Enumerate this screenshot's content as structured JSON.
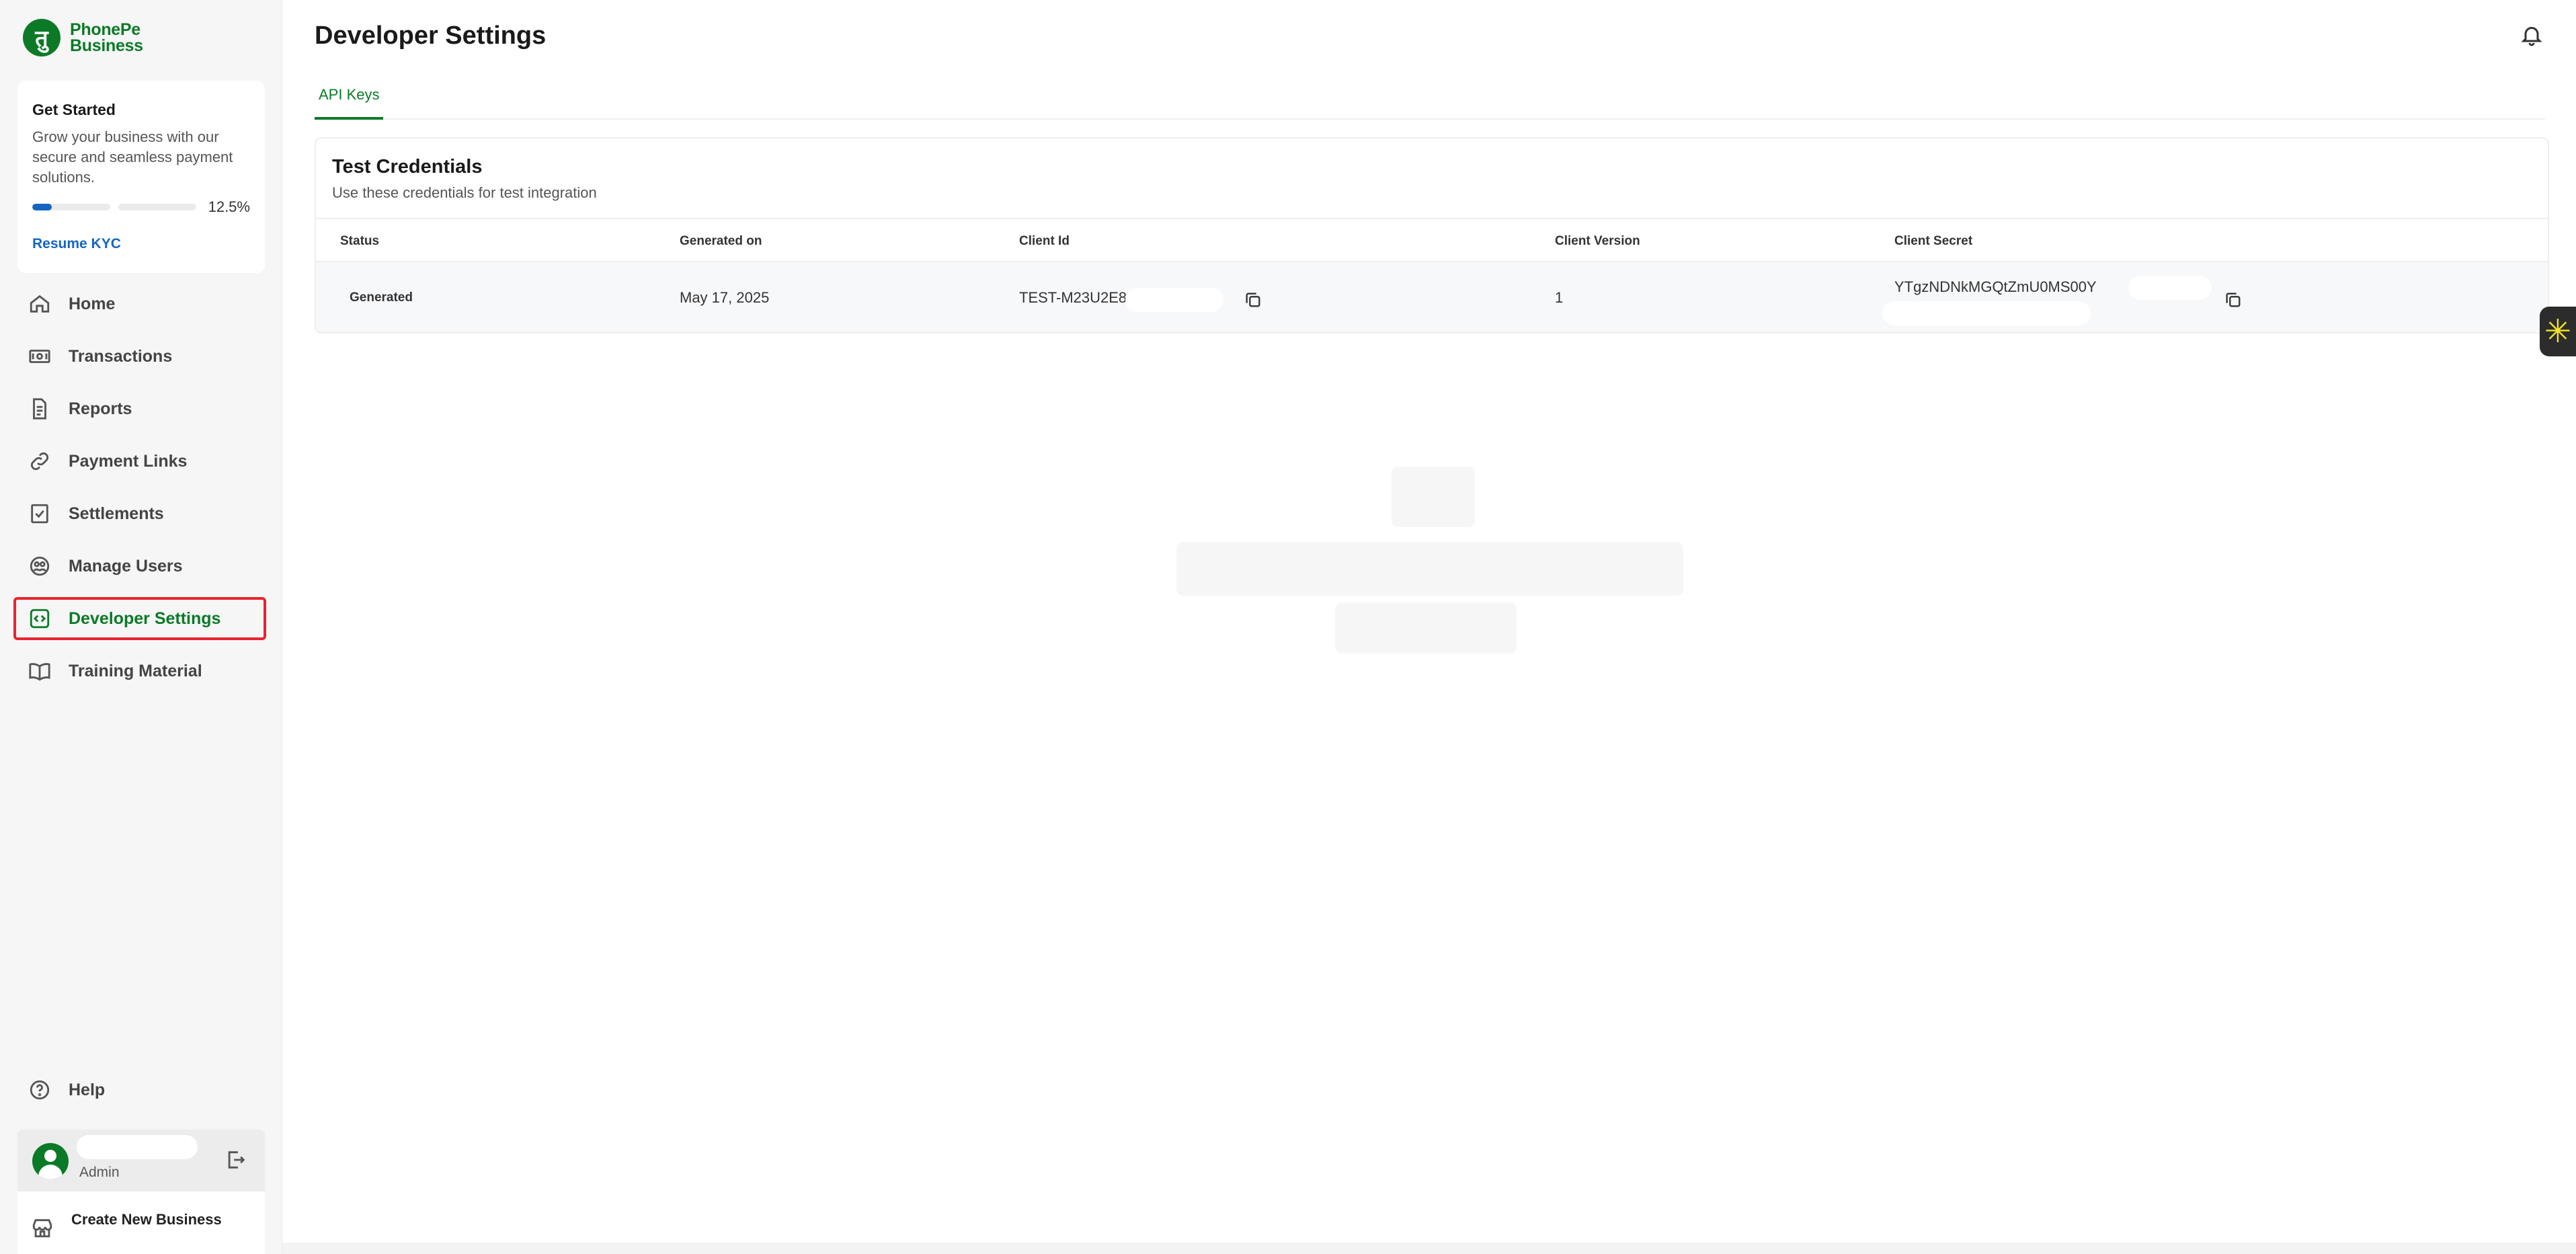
{
  "brand": {
    "line1": "PhonePe",
    "line2": "Business",
    "mark": "तु"
  },
  "get_started": {
    "title": "Get Started",
    "description": "Grow your business with our secure and seamless payment solutions.",
    "progress_percent": 12.5,
    "progress_label": "12.5%",
    "action_label": "Resume KYC"
  },
  "nav": {
    "items": [
      {
        "label": "Home",
        "icon": "home-icon"
      },
      {
        "label": "Transactions",
        "icon": "transactions-icon"
      },
      {
        "label": "Reports",
        "icon": "reports-icon"
      },
      {
        "label": "Payment Links",
        "icon": "link-icon"
      },
      {
        "label": "Settlements",
        "icon": "settlements-icon"
      },
      {
        "label": "Manage Users",
        "icon": "users-icon"
      },
      {
        "label": "Developer Settings",
        "icon": "code-icon",
        "active": true
      },
      {
        "label": "Training Material",
        "icon": "book-icon"
      }
    ],
    "help_label": "Help"
  },
  "user": {
    "role": "Admin"
  },
  "create_business_label": "Create New Business",
  "page": {
    "title": "Developer Settings"
  },
  "tabs": [
    {
      "label": "API Keys",
      "active": true
    }
  ],
  "credentials": {
    "title": "Test Credentials",
    "subtitle": "Use these credentials for test integration",
    "columns": {
      "status": "Status",
      "generated_on": "Generated on",
      "client_id": "Client Id",
      "client_version": "Client Version",
      "client_secret": "Client Secret"
    },
    "row": {
      "status": "Generated",
      "generated_on": "May 17, 2025",
      "client_id": "TEST-M23U2E8",
      "client_version": "1",
      "client_secret": "YTgzNDNkMGQtZmU0MS00Y"
    }
  },
  "colors": {
    "brand_green": "#0b7a27",
    "link_blue": "#1565c0",
    "highlight_red": "#e8232e"
  }
}
